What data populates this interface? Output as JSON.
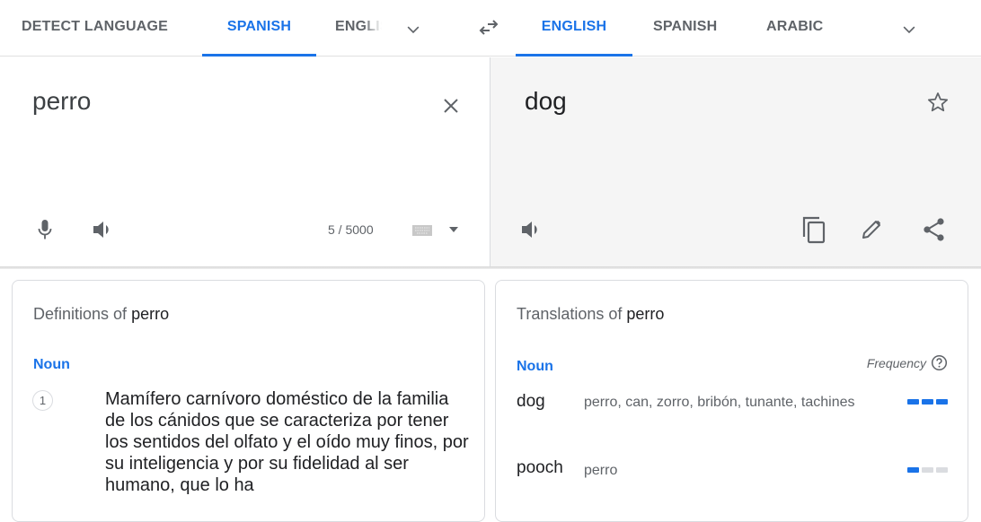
{
  "source_languages": {
    "tabs": [
      {
        "label": "DETECT LANGUAGE",
        "active": false
      },
      {
        "label": "SPANISH",
        "active": true
      },
      {
        "label": "ENGLISH",
        "active": false
      }
    ],
    "more_icon": "chevron-down-icon"
  },
  "swap_icon": "swap-languages-icon",
  "target_languages": {
    "tabs": [
      {
        "label": "ENGLISH",
        "active": true
      },
      {
        "label": "SPANISH",
        "active": false
      },
      {
        "label": "ARABIC",
        "active": false
      }
    ],
    "more_icon": "chevron-down-icon"
  },
  "source": {
    "text": "perro",
    "char_count": "5 / 5000",
    "icons": [
      "close-icon",
      "microphone-icon",
      "speaker-icon",
      "keyboard-icon",
      "dropdown-icon"
    ]
  },
  "target": {
    "text": "dog",
    "icons": [
      "star-icon",
      "speaker-icon",
      "copy-icon",
      "edit-icon",
      "share-icon"
    ]
  },
  "definitions": {
    "title_prefix": "Definitions of",
    "word": "perro",
    "part_of_speech": "Noun",
    "items": [
      {
        "number": "1",
        "text": "Mamífero carnívoro doméstico de la familia de los cánidos que se caracteriza por tener los sentidos del olfato y el oído muy finos, por su inteligencia y por su fidelidad al ser humano, que lo ha"
      }
    ]
  },
  "translations": {
    "title_prefix": "Translations of",
    "word": "perro",
    "part_of_speech": "Noun",
    "frequency_label": "Frequency",
    "rows": [
      {
        "word": "dog",
        "back_translations": "perro, can, zorro, bribón, tunante, tachines",
        "frequency": 3,
        "frequency_max": 3
      },
      {
        "word": "pooch",
        "back_translations": "perro",
        "frequency": 1,
        "frequency_max": 3
      }
    ]
  },
  "colors": {
    "accent": "#1a73e8",
    "icon": "#5f6368",
    "target_bg": "#f5f5f5",
    "freq_off": "#dadce0"
  }
}
